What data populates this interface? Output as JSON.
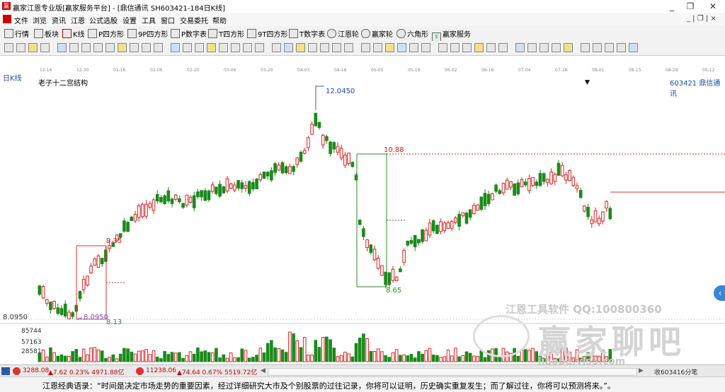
{
  "window": {
    "title": "赢家江恩专业版[赢家服务平台] - [鼎信通讯  SH603421-184日K线]",
    "controls": [
      "_",
      "❐",
      "✕"
    ]
  },
  "menu": {
    "items": [
      "文件",
      "浏览",
      "资讯",
      "江恩",
      "公式选股",
      "设置",
      "工具",
      "窗口",
      "交易委托",
      "帮助"
    ],
    "right_controls": "_ | ❐ | ×"
  },
  "toolbar": {
    "items": [
      "行情",
      "板块",
      "K线",
      "P四方形",
      "9P四方形",
      "P数字表",
      "T四方形",
      "9T四方形",
      "T数字表",
      "江恩轮",
      "赢家轮",
      "六角形",
      "赢家服务"
    ]
  },
  "date_axis": [
    "12-16",
    "12-30",
    "01-16",
    "02-06",
    "02-20",
    "03-06",
    "03-20",
    "04-03",
    "04-18",
    "05-05",
    "05-19",
    "06-02",
    "06-16",
    "07-04",
    "07-18",
    "08-01",
    "08-15",
    "08-29",
    "09-12"
  ],
  "chart": {
    "period_label": "日K线",
    "indicator_name": "老子十二宫结构",
    "stock_code_name": "603421  鼎信通讯",
    "high_label": "12.0450",
    "low_label": "8.0950",
    "left_price": "8.0950",
    "level_1088": "10.88",
    "level_935": "9.35",
    "level_813": "8.13",
    "level_865": "8.65"
  },
  "volume": {
    "tick_1": "85744",
    "tick_2": "57163",
    "tick_3": "28581"
  },
  "watermark": {
    "line1": "江恩工具软件  QQ:100800360",
    "brand": "赢家聊吧",
    "site": "liaoba.yjs3.com"
  },
  "chart_data": {
    "type": "candlestick",
    "x_start": "12-16",
    "x_end": "09-12",
    "y_high": 12.045,
    "y_low": 8.095,
    "levels": [
      10.88,
      9.35,
      8.13,
      8.65
    ]
  },
  "taskbar": {
    "sh_index": "3288.08",
    "sh_change": "▲7.62  0.23%  4971.88亿",
    "sz_index": "11238.06",
    "sz_change": "▲74.64  0.67%  5519.72亿",
    "ticker": "收603416分笔"
  },
  "footer": {
    "quote": "江恩经典语录：“时间是决定市场走势的重要因素，经过详细研究大市及个别股票的过往记录，你将可以证明，历史确实重复发生；而了解过往，你将可以预测将来。”。"
  }
}
